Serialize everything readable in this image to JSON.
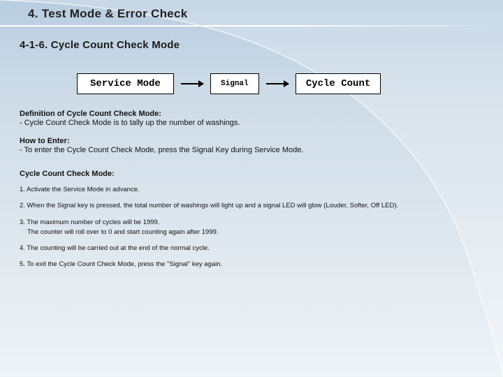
{
  "header": "4. Test Mode & Error Check",
  "subheader": "4-1-6.  Cycle Count Check Mode",
  "flow": {
    "box1": "Service Mode",
    "box2": "Signal",
    "box3": "Cycle Count"
  },
  "def": {
    "title": "Definition of Cycle Count Check Mode:",
    "line": "- Cycle Count Check Mode is to tally up the number of washings."
  },
  "enter": {
    "title": "How to Enter:",
    "line": "- To enter the Cycle Count Check Mode, press the Signal Key during Service Mode."
  },
  "mode": {
    "title": "Cycle Count Check Mode:",
    "s1": "1. Activate the Service Mode in advance.",
    "s2": "2. When the Signal key is pressed, the total number of washings will light up and a signal LED will glow (Louder, Softer, Off LED).",
    "s3a": "3. The maximum number of cycles will be 1999.",
    "s3b": "The counter will roll over to 0 and start counting again after 1999.",
    "s4": "4. The counting will be carried out at the end of the normal cycle.",
    "s5": "5. To exit the Cycle Count Check Mode, press the \"Signal\" key again."
  }
}
